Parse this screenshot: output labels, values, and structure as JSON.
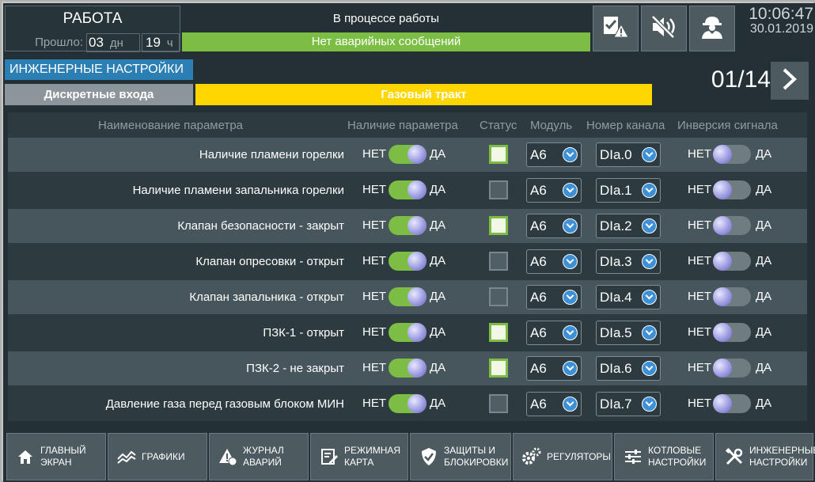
{
  "header": {
    "mode": "РАБОТА",
    "elapsed_label": "Прошло:",
    "days_value": "03",
    "days_unit": "дн",
    "hours_value": "19",
    "hours_unit": "ч",
    "status": "В процессе работы",
    "alarm": "Нет аварийных сообщений",
    "time": "10:06:47",
    "date": "30.01.2019",
    "buttons": [
      {
        "icon": "alarm-ack-icon"
      },
      {
        "icon": "sound-mute-icon"
      },
      {
        "icon": "operator-icon"
      }
    ]
  },
  "section": {
    "title": "ИНЖЕНЕРНЫЕ НАСТРОЙКИ",
    "subtab": "Дискретные входа",
    "group": "Газовый тракт",
    "page": "01/14"
  },
  "table": {
    "headers": {
      "name": "Наименование параметра",
      "presence": "Наличие параметра",
      "status": "Статус",
      "module": "Модуль",
      "channel": "Номер канала",
      "inversion": "Инверсия сигнала"
    },
    "no_label": "НЕТ",
    "yes_label": "ДА",
    "rows": [
      {
        "name": "Наличие пламени горелки",
        "presence": "on",
        "status": true,
        "module": "A6",
        "channel": "DIa.0",
        "inversion": "off"
      },
      {
        "name": "Наличие пламени запальника горелки",
        "presence": "on",
        "status": false,
        "module": "A6",
        "channel": "DIa.1",
        "inversion": "off"
      },
      {
        "name": "Клапан безопасности - закрыт",
        "presence": "on",
        "status": true,
        "module": "A6",
        "channel": "DIa.2",
        "inversion": "off"
      },
      {
        "name": "Клапан опресовки - открыт",
        "presence": "on",
        "status": false,
        "module": "A6",
        "channel": "DIa.3",
        "inversion": "off"
      },
      {
        "name": "Клапан запальника - открыт",
        "presence": "on",
        "status": false,
        "module": "A6",
        "channel": "DIa.4",
        "inversion": "off"
      },
      {
        "name": "ПЗК-1 - открыт",
        "presence": "on",
        "status": true,
        "module": "A6",
        "channel": "DIa.5",
        "inversion": "off"
      },
      {
        "name": "ПЗК-2 - не закрыт",
        "presence": "on",
        "status": true,
        "module": "A6",
        "channel": "DIa.6",
        "inversion": "off"
      },
      {
        "name": "Давление газа перед газовым блоком МИН",
        "presence": "on",
        "status": false,
        "module": "A6",
        "channel": "DIa.7",
        "inversion": "off"
      }
    ]
  },
  "nav": [
    {
      "label": "ГЛАВНЫЙ\nЭКРАН",
      "icon": "home-icon"
    },
    {
      "label": "ГРАФИКИ",
      "icon": "chart-icon"
    },
    {
      "label": "ЖУРНАЛ\nАВАРИЙ",
      "icon": "alarm-log-icon"
    },
    {
      "label": "РЕЖИМНАЯ\nКАРТА",
      "icon": "mode-map-icon"
    },
    {
      "label": "ЗАЩИТЫ И\nБЛОКИРОВКИ",
      "icon": "shield-icon"
    },
    {
      "label": "РЕГУЛЯТОРЫ",
      "icon": "gears-icon"
    },
    {
      "label": "КОТЛОВЫЕ\nНАСТРОЙКИ",
      "icon": "sliders-icon"
    },
    {
      "label": "ИНЖЕНЕРНЫЕ\nНАСТРОЙКИ",
      "icon": "tools-icon"
    }
  ],
  "colors": {
    "background": "#243035",
    "accent_green": "#7cbd44",
    "accent_yellow": "#ffd600",
    "accent_blue": "#2c7fb4"
  }
}
